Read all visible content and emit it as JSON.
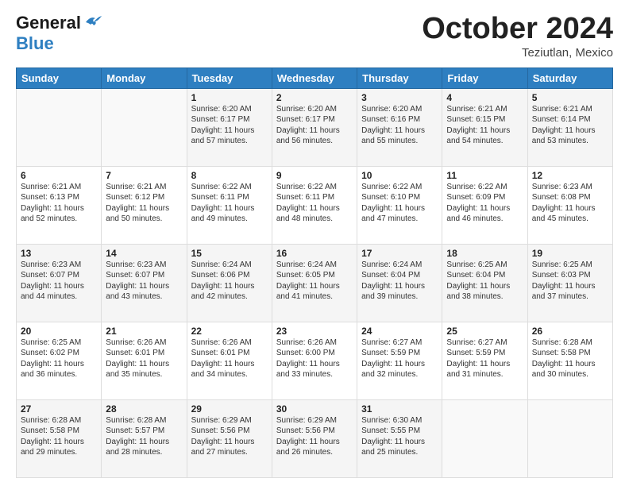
{
  "header": {
    "logo_line1": "General",
    "logo_line2": "Blue",
    "month": "October 2024",
    "location": "Teziutlan, Mexico"
  },
  "weekdays": [
    "Sunday",
    "Monday",
    "Tuesday",
    "Wednesday",
    "Thursday",
    "Friday",
    "Saturday"
  ],
  "weeks": [
    [
      {
        "day": "",
        "sunrise": "",
        "sunset": "",
        "daylight": ""
      },
      {
        "day": "",
        "sunrise": "",
        "sunset": "",
        "daylight": ""
      },
      {
        "day": "1",
        "sunrise": "Sunrise: 6:20 AM",
        "sunset": "Sunset: 6:17 PM",
        "daylight": "Daylight: 11 hours and 57 minutes."
      },
      {
        "day": "2",
        "sunrise": "Sunrise: 6:20 AM",
        "sunset": "Sunset: 6:17 PM",
        "daylight": "Daylight: 11 hours and 56 minutes."
      },
      {
        "day": "3",
        "sunrise": "Sunrise: 6:20 AM",
        "sunset": "Sunset: 6:16 PM",
        "daylight": "Daylight: 11 hours and 55 minutes."
      },
      {
        "day": "4",
        "sunrise": "Sunrise: 6:21 AM",
        "sunset": "Sunset: 6:15 PM",
        "daylight": "Daylight: 11 hours and 54 minutes."
      },
      {
        "day": "5",
        "sunrise": "Sunrise: 6:21 AM",
        "sunset": "Sunset: 6:14 PM",
        "daylight": "Daylight: 11 hours and 53 minutes."
      }
    ],
    [
      {
        "day": "6",
        "sunrise": "Sunrise: 6:21 AM",
        "sunset": "Sunset: 6:13 PM",
        "daylight": "Daylight: 11 hours and 52 minutes."
      },
      {
        "day": "7",
        "sunrise": "Sunrise: 6:21 AM",
        "sunset": "Sunset: 6:12 PM",
        "daylight": "Daylight: 11 hours and 50 minutes."
      },
      {
        "day": "8",
        "sunrise": "Sunrise: 6:22 AM",
        "sunset": "Sunset: 6:11 PM",
        "daylight": "Daylight: 11 hours and 49 minutes."
      },
      {
        "day": "9",
        "sunrise": "Sunrise: 6:22 AM",
        "sunset": "Sunset: 6:11 PM",
        "daylight": "Daylight: 11 hours and 48 minutes."
      },
      {
        "day": "10",
        "sunrise": "Sunrise: 6:22 AM",
        "sunset": "Sunset: 6:10 PM",
        "daylight": "Daylight: 11 hours and 47 minutes."
      },
      {
        "day": "11",
        "sunrise": "Sunrise: 6:22 AM",
        "sunset": "Sunset: 6:09 PM",
        "daylight": "Daylight: 11 hours and 46 minutes."
      },
      {
        "day": "12",
        "sunrise": "Sunrise: 6:23 AM",
        "sunset": "Sunset: 6:08 PM",
        "daylight": "Daylight: 11 hours and 45 minutes."
      }
    ],
    [
      {
        "day": "13",
        "sunrise": "Sunrise: 6:23 AM",
        "sunset": "Sunset: 6:07 PM",
        "daylight": "Daylight: 11 hours and 44 minutes."
      },
      {
        "day": "14",
        "sunrise": "Sunrise: 6:23 AM",
        "sunset": "Sunset: 6:07 PM",
        "daylight": "Daylight: 11 hours and 43 minutes."
      },
      {
        "day": "15",
        "sunrise": "Sunrise: 6:24 AM",
        "sunset": "Sunset: 6:06 PM",
        "daylight": "Daylight: 11 hours and 42 minutes."
      },
      {
        "day": "16",
        "sunrise": "Sunrise: 6:24 AM",
        "sunset": "Sunset: 6:05 PM",
        "daylight": "Daylight: 11 hours and 41 minutes."
      },
      {
        "day": "17",
        "sunrise": "Sunrise: 6:24 AM",
        "sunset": "Sunset: 6:04 PM",
        "daylight": "Daylight: 11 hours and 39 minutes."
      },
      {
        "day": "18",
        "sunrise": "Sunrise: 6:25 AM",
        "sunset": "Sunset: 6:04 PM",
        "daylight": "Daylight: 11 hours and 38 minutes."
      },
      {
        "day": "19",
        "sunrise": "Sunrise: 6:25 AM",
        "sunset": "Sunset: 6:03 PM",
        "daylight": "Daylight: 11 hours and 37 minutes."
      }
    ],
    [
      {
        "day": "20",
        "sunrise": "Sunrise: 6:25 AM",
        "sunset": "Sunset: 6:02 PM",
        "daylight": "Daylight: 11 hours and 36 minutes."
      },
      {
        "day": "21",
        "sunrise": "Sunrise: 6:26 AM",
        "sunset": "Sunset: 6:01 PM",
        "daylight": "Daylight: 11 hours and 35 minutes."
      },
      {
        "day": "22",
        "sunrise": "Sunrise: 6:26 AM",
        "sunset": "Sunset: 6:01 PM",
        "daylight": "Daylight: 11 hours and 34 minutes."
      },
      {
        "day": "23",
        "sunrise": "Sunrise: 6:26 AM",
        "sunset": "Sunset: 6:00 PM",
        "daylight": "Daylight: 11 hours and 33 minutes."
      },
      {
        "day": "24",
        "sunrise": "Sunrise: 6:27 AM",
        "sunset": "Sunset: 5:59 PM",
        "daylight": "Daylight: 11 hours and 32 minutes."
      },
      {
        "day": "25",
        "sunrise": "Sunrise: 6:27 AM",
        "sunset": "Sunset: 5:59 PM",
        "daylight": "Daylight: 11 hours and 31 minutes."
      },
      {
        "day": "26",
        "sunrise": "Sunrise: 6:28 AM",
        "sunset": "Sunset: 5:58 PM",
        "daylight": "Daylight: 11 hours and 30 minutes."
      }
    ],
    [
      {
        "day": "27",
        "sunrise": "Sunrise: 6:28 AM",
        "sunset": "Sunset: 5:58 PM",
        "daylight": "Daylight: 11 hours and 29 minutes."
      },
      {
        "day": "28",
        "sunrise": "Sunrise: 6:28 AM",
        "sunset": "Sunset: 5:57 PM",
        "daylight": "Daylight: 11 hours and 28 minutes."
      },
      {
        "day": "29",
        "sunrise": "Sunrise: 6:29 AM",
        "sunset": "Sunset: 5:56 PM",
        "daylight": "Daylight: 11 hours and 27 minutes."
      },
      {
        "day": "30",
        "sunrise": "Sunrise: 6:29 AM",
        "sunset": "Sunset: 5:56 PM",
        "daylight": "Daylight: 11 hours and 26 minutes."
      },
      {
        "day": "31",
        "sunrise": "Sunrise: 6:30 AM",
        "sunset": "Sunset: 5:55 PM",
        "daylight": "Daylight: 11 hours and 25 minutes."
      },
      {
        "day": "",
        "sunrise": "",
        "sunset": "",
        "daylight": ""
      },
      {
        "day": "",
        "sunrise": "",
        "sunset": "",
        "daylight": ""
      }
    ]
  ]
}
